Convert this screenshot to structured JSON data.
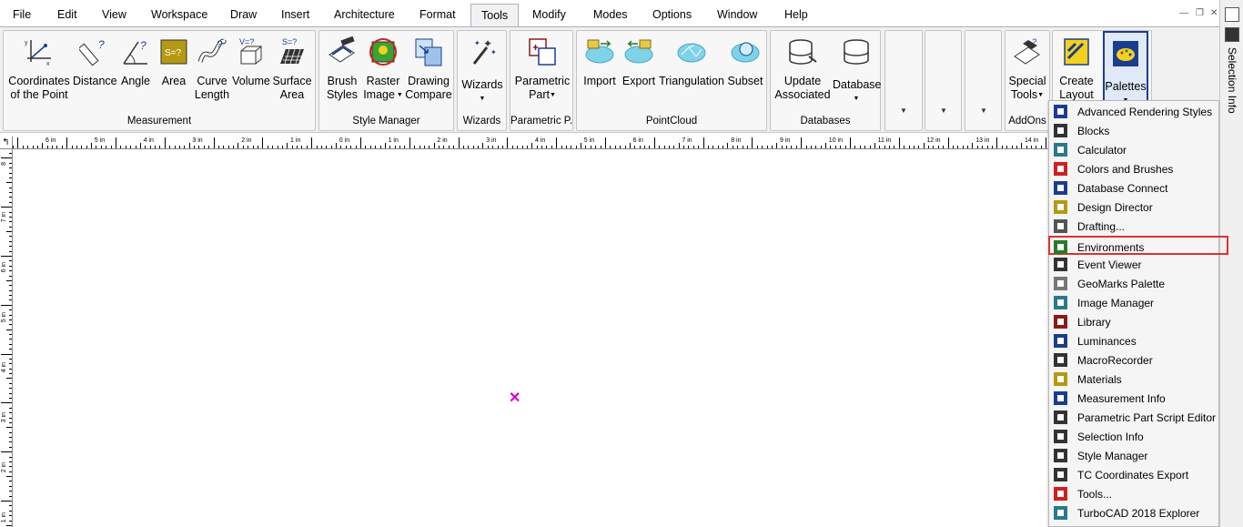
{
  "menubar": {
    "items": [
      "File",
      "Edit",
      "View",
      "Workspace",
      "Draw",
      "Insert",
      "Architecture",
      "Format",
      "Tools",
      "Modify",
      "Modes",
      "Options",
      "Window",
      "Help"
    ],
    "active": "Tools"
  },
  "ribbon": {
    "groups": [
      {
        "label": "Measurement",
        "buttons": [
          "Coordinates of the Point",
          "Distance",
          "Angle",
          "Area",
          "Curve Length",
          "Volume",
          "Surface Area"
        ]
      },
      {
        "label": "Style Manager",
        "buttons": [
          "Brush Styles",
          "Raster Image",
          "Drawing Compare"
        ]
      },
      {
        "label": "Wizards",
        "buttons": [
          "Wizards"
        ]
      },
      {
        "label": "Parametric P...",
        "buttons": [
          "Parametric Part"
        ]
      },
      {
        "label": "PointCloud",
        "buttons": [
          "Import",
          "Export",
          "Triangulation",
          "Subset"
        ]
      },
      {
        "label": "Databases",
        "buttons": [
          "Update Associated",
          "Database"
        ]
      },
      {
        "label": "AddOns",
        "buttons": [
          "Special Tools"
        ]
      },
      {
        "label": "",
        "buttons": [
          "Create Layout",
          "Palettes"
        ]
      }
    ],
    "measurement": {
      "coords_line1": "Coordinates",
      "coords_line2": "of the Point",
      "distance": "Distance",
      "angle": "Angle",
      "area": "Area",
      "curve_line1": "Curve",
      "curve_line2": "Length",
      "volume": "Volume",
      "surface_line1": "Surface",
      "surface_line2": "Area",
      "label": "Measurement"
    },
    "style": {
      "brush_line1": "Brush",
      "brush_line2": "Styles",
      "raster_line1": "Raster",
      "raster_line2": "Image",
      "compare_line1": "Drawing",
      "compare_line2": "Compare",
      "label": "Style Manager"
    },
    "wizards": {
      "button": "Wizards",
      "label": "Wizards"
    },
    "parametric": {
      "line1": "Parametric",
      "line2": "Part",
      "label": "Parametric P..."
    },
    "pointcloud": {
      "import": "Import",
      "export": "Export",
      "triangulation": "Triangulation",
      "subset": "Subset",
      "label": "PointCloud"
    },
    "databases": {
      "update_line1": "Update",
      "update_line2": "Associated",
      "database": "Database",
      "label": "Databases"
    },
    "addons": {
      "special_line1": "Special",
      "special_line2": "Tools",
      "label": "AddOns"
    },
    "layout": {
      "create_line1": "Create",
      "create_line2": "Layout",
      "palettes": "Palettes"
    },
    "icon_text": {
      "area": "S=?",
      "volume": "V=?",
      "surface": "S=?"
    }
  },
  "sidebar": {
    "title": "Selection Info"
  },
  "ruler": {
    "h_labels": [
      "6 in",
      "5 in",
      "4 in",
      "3 in",
      "2 in",
      "1 in",
      "0 in",
      "1 in",
      "2 in",
      "3 in",
      "4 in",
      "5 in",
      "6 in",
      "7 in",
      "8 in",
      "9 in",
      "10 in",
      "11 in",
      "12 in",
      "13 in",
      "14 in"
    ],
    "v_labels": [
      "8",
      "7 in",
      "6 in",
      "5 in",
      "4 in",
      "3 in",
      "2 in",
      "1 in"
    ]
  },
  "palettes_menu": {
    "highlighted": "Environments",
    "items": [
      {
        "label": "Advanced Rendering Styles",
        "icon": "rendering-styles-icon"
      },
      {
        "label": "Blocks",
        "icon": "blocks-icon"
      },
      {
        "label": "Calculator",
        "icon": "calculator-icon"
      },
      {
        "label": "Colors and Brushes",
        "icon": "colors-brushes-icon"
      },
      {
        "label": "Database Connect",
        "icon": "database-connect-icon"
      },
      {
        "label": "Design Director",
        "icon": "design-director-icon"
      },
      {
        "label": "Drafting...",
        "icon": "drafting-icon"
      },
      {
        "label": "Environments",
        "icon": "environments-icon"
      },
      {
        "label": "Event Viewer",
        "icon": "event-viewer-icon"
      },
      {
        "label": "GeoMarks Palette",
        "icon": "geomarks-icon"
      },
      {
        "label": "Image Manager",
        "icon": "image-manager-icon"
      },
      {
        "label": "Library",
        "icon": "library-icon"
      },
      {
        "label": "Luminances",
        "icon": "luminances-icon"
      },
      {
        "label": "MacroRecorder",
        "icon": "macro-recorder-icon"
      },
      {
        "label": "Materials",
        "icon": "materials-icon"
      },
      {
        "label": "Measurement Info",
        "icon": "measurement-info-icon"
      },
      {
        "label": "Parametric Part Script Editor",
        "icon": "script-editor-icon"
      },
      {
        "label": "Selection Info",
        "icon": "selection-info-icon"
      },
      {
        "label": "Style Manager",
        "icon": "style-manager-icon"
      },
      {
        "label": "TC Coordinates Export",
        "icon": "coordinates-export-icon"
      },
      {
        "label": "Tools...",
        "icon": "tools-icon"
      },
      {
        "label": "TurboCAD 2018 Explorer",
        "icon": "explorer-icon"
      }
    ]
  },
  "colors": {
    "highlight_border": "#e03030",
    "cursor": "#d400d4",
    "accent_blue": "#1a3d8f"
  }
}
